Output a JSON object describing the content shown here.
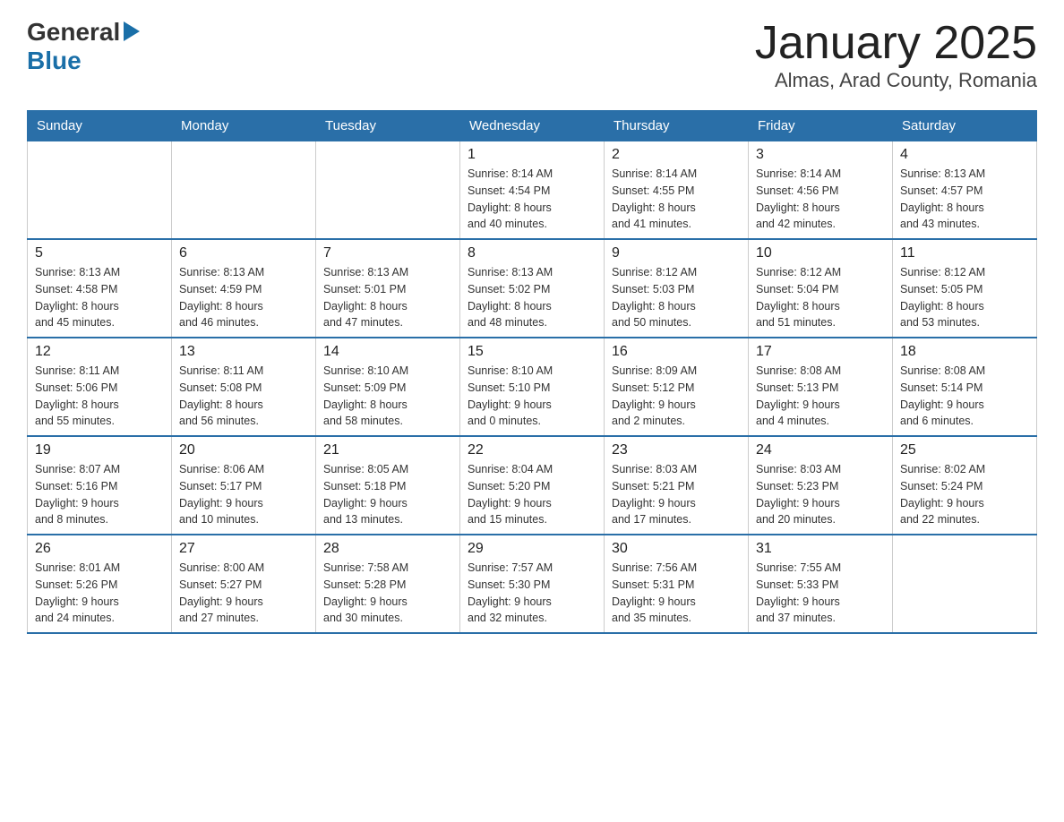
{
  "logo": {
    "general": "General",
    "blue": "Blue",
    "arrow": "▶"
  },
  "title": "January 2025",
  "subtitle": "Almas, Arad County, Romania",
  "weekdays": [
    "Sunday",
    "Monday",
    "Tuesday",
    "Wednesday",
    "Thursday",
    "Friday",
    "Saturday"
  ],
  "weeks": [
    [
      {
        "day": "",
        "info": ""
      },
      {
        "day": "",
        "info": ""
      },
      {
        "day": "",
        "info": ""
      },
      {
        "day": "1",
        "info": "Sunrise: 8:14 AM\nSunset: 4:54 PM\nDaylight: 8 hours\nand 40 minutes."
      },
      {
        "day": "2",
        "info": "Sunrise: 8:14 AM\nSunset: 4:55 PM\nDaylight: 8 hours\nand 41 minutes."
      },
      {
        "day": "3",
        "info": "Sunrise: 8:14 AM\nSunset: 4:56 PM\nDaylight: 8 hours\nand 42 minutes."
      },
      {
        "day": "4",
        "info": "Sunrise: 8:13 AM\nSunset: 4:57 PM\nDaylight: 8 hours\nand 43 minutes."
      }
    ],
    [
      {
        "day": "5",
        "info": "Sunrise: 8:13 AM\nSunset: 4:58 PM\nDaylight: 8 hours\nand 45 minutes."
      },
      {
        "day": "6",
        "info": "Sunrise: 8:13 AM\nSunset: 4:59 PM\nDaylight: 8 hours\nand 46 minutes."
      },
      {
        "day": "7",
        "info": "Sunrise: 8:13 AM\nSunset: 5:01 PM\nDaylight: 8 hours\nand 47 minutes."
      },
      {
        "day": "8",
        "info": "Sunrise: 8:13 AM\nSunset: 5:02 PM\nDaylight: 8 hours\nand 48 minutes."
      },
      {
        "day": "9",
        "info": "Sunrise: 8:12 AM\nSunset: 5:03 PM\nDaylight: 8 hours\nand 50 minutes."
      },
      {
        "day": "10",
        "info": "Sunrise: 8:12 AM\nSunset: 5:04 PM\nDaylight: 8 hours\nand 51 minutes."
      },
      {
        "day": "11",
        "info": "Sunrise: 8:12 AM\nSunset: 5:05 PM\nDaylight: 8 hours\nand 53 minutes."
      }
    ],
    [
      {
        "day": "12",
        "info": "Sunrise: 8:11 AM\nSunset: 5:06 PM\nDaylight: 8 hours\nand 55 minutes."
      },
      {
        "day": "13",
        "info": "Sunrise: 8:11 AM\nSunset: 5:08 PM\nDaylight: 8 hours\nand 56 minutes."
      },
      {
        "day": "14",
        "info": "Sunrise: 8:10 AM\nSunset: 5:09 PM\nDaylight: 8 hours\nand 58 minutes."
      },
      {
        "day": "15",
        "info": "Sunrise: 8:10 AM\nSunset: 5:10 PM\nDaylight: 9 hours\nand 0 minutes."
      },
      {
        "day": "16",
        "info": "Sunrise: 8:09 AM\nSunset: 5:12 PM\nDaylight: 9 hours\nand 2 minutes."
      },
      {
        "day": "17",
        "info": "Sunrise: 8:08 AM\nSunset: 5:13 PM\nDaylight: 9 hours\nand 4 minutes."
      },
      {
        "day": "18",
        "info": "Sunrise: 8:08 AM\nSunset: 5:14 PM\nDaylight: 9 hours\nand 6 minutes."
      }
    ],
    [
      {
        "day": "19",
        "info": "Sunrise: 8:07 AM\nSunset: 5:16 PM\nDaylight: 9 hours\nand 8 minutes."
      },
      {
        "day": "20",
        "info": "Sunrise: 8:06 AM\nSunset: 5:17 PM\nDaylight: 9 hours\nand 10 minutes."
      },
      {
        "day": "21",
        "info": "Sunrise: 8:05 AM\nSunset: 5:18 PM\nDaylight: 9 hours\nand 13 minutes."
      },
      {
        "day": "22",
        "info": "Sunrise: 8:04 AM\nSunset: 5:20 PM\nDaylight: 9 hours\nand 15 minutes."
      },
      {
        "day": "23",
        "info": "Sunrise: 8:03 AM\nSunset: 5:21 PM\nDaylight: 9 hours\nand 17 minutes."
      },
      {
        "day": "24",
        "info": "Sunrise: 8:03 AM\nSunset: 5:23 PM\nDaylight: 9 hours\nand 20 minutes."
      },
      {
        "day": "25",
        "info": "Sunrise: 8:02 AM\nSunset: 5:24 PM\nDaylight: 9 hours\nand 22 minutes."
      }
    ],
    [
      {
        "day": "26",
        "info": "Sunrise: 8:01 AM\nSunset: 5:26 PM\nDaylight: 9 hours\nand 24 minutes."
      },
      {
        "day": "27",
        "info": "Sunrise: 8:00 AM\nSunset: 5:27 PM\nDaylight: 9 hours\nand 27 minutes."
      },
      {
        "day": "28",
        "info": "Sunrise: 7:58 AM\nSunset: 5:28 PM\nDaylight: 9 hours\nand 30 minutes."
      },
      {
        "day": "29",
        "info": "Sunrise: 7:57 AM\nSunset: 5:30 PM\nDaylight: 9 hours\nand 32 minutes."
      },
      {
        "day": "30",
        "info": "Sunrise: 7:56 AM\nSunset: 5:31 PM\nDaylight: 9 hours\nand 35 minutes."
      },
      {
        "day": "31",
        "info": "Sunrise: 7:55 AM\nSunset: 5:33 PM\nDaylight: 9 hours\nand 37 minutes."
      },
      {
        "day": "",
        "info": ""
      }
    ]
  ]
}
